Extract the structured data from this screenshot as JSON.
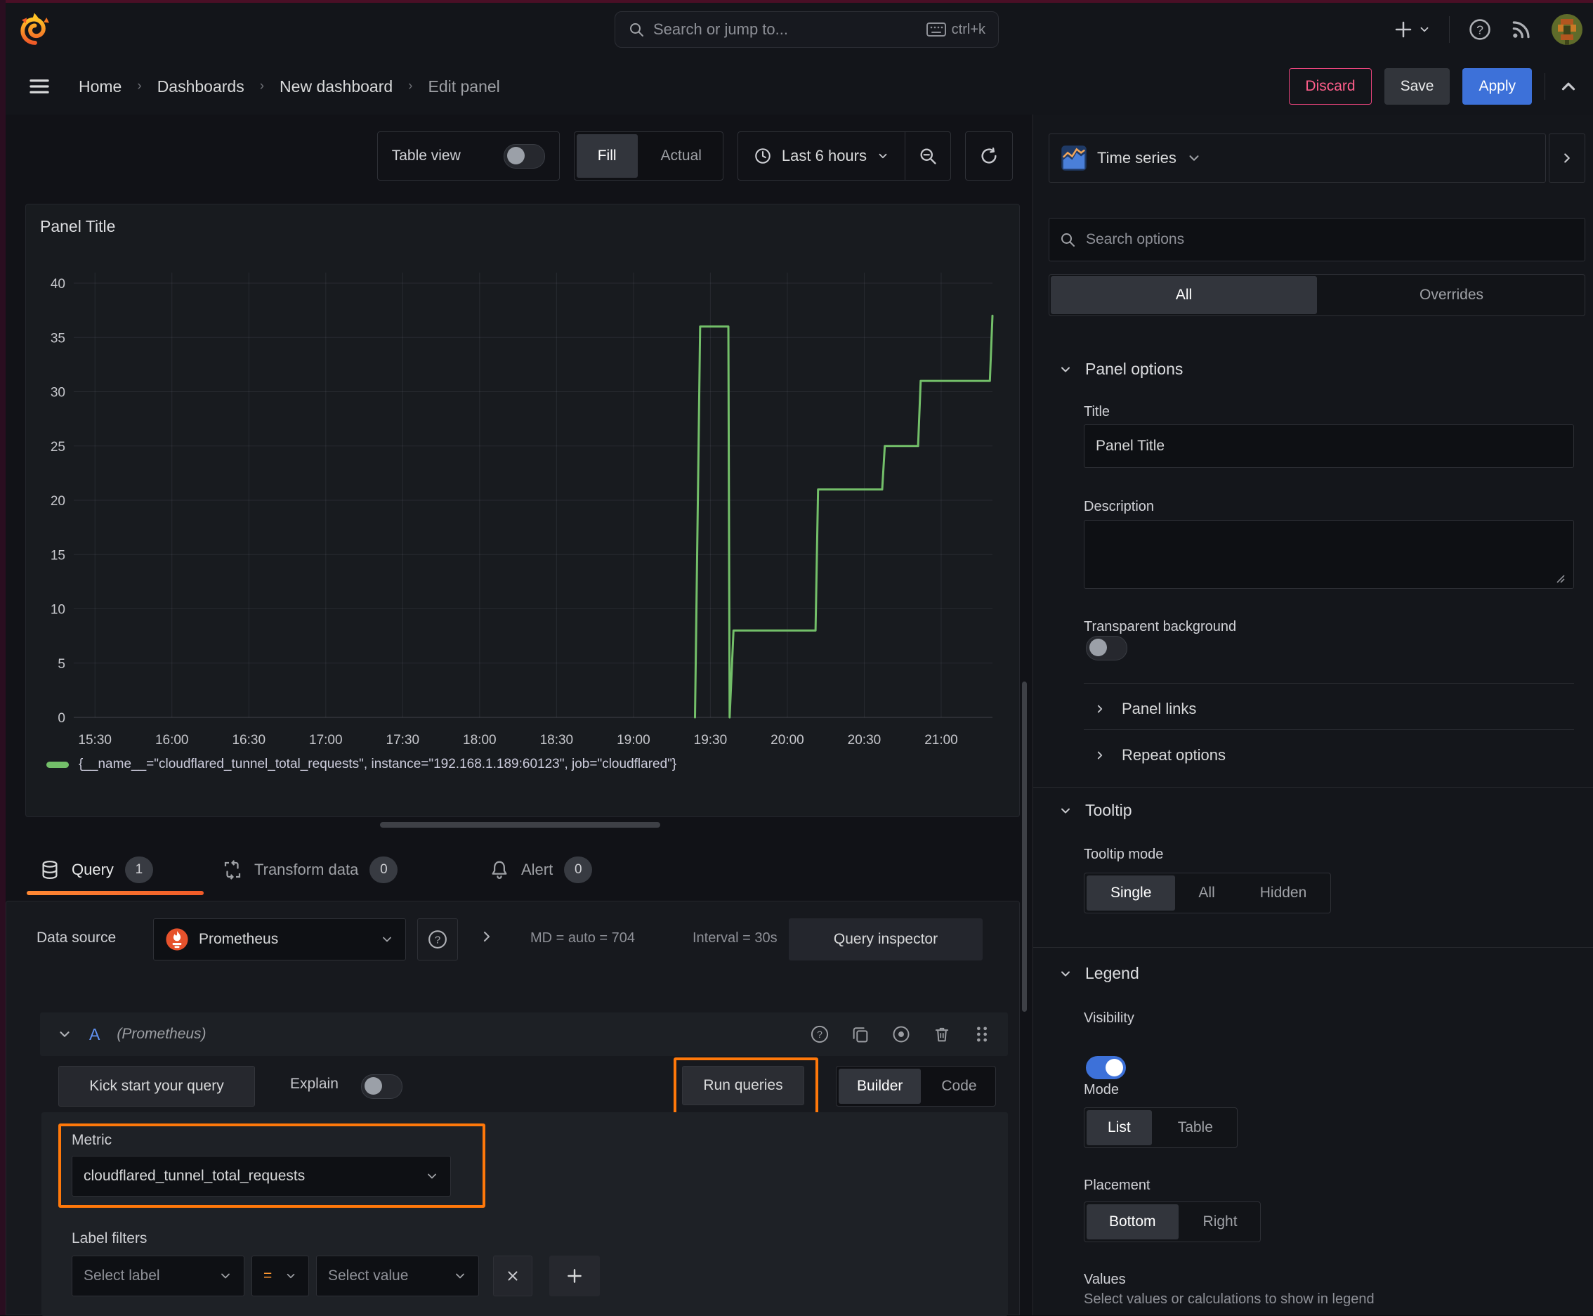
{
  "topbar": {
    "search_placeholder": "Search or jump to...",
    "shortcut": "ctrl+k"
  },
  "breadcrumb": {
    "items": [
      "Home",
      "Dashboards",
      "New dashboard",
      "Edit panel"
    ],
    "discard": "Discard",
    "save": "Save",
    "apply": "Apply"
  },
  "toolbar": {
    "table_view": "Table view",
    "fill": "Fill",
    "actual": "Actual",
    "time_range": "Last 6 hours"
  },
  "vis_picker": {
    "label": "Time series"
  },
  "panel": {
    "title": "Panel Title"
  },
  "chart_data": {
    "type": "line",
    "title": "Panel Title",
    "x_ticks": [
      "15:30",
      "16:00",
      "16:30",
      "17:00",
      "17:30",
      "18:00",
      "18:30",
      "19:00",
      "19:30",
      "20:00",
      "20:30",
      "21:00"
    ],
    "x_domain_minutes": [
      -8,
      350
    ],
    "y_ticks": [
      0,
      5,
      10,
      15,
      20,
      25,
      30,
      35,
      40
    ],
    "ylim": [
      0,
      40
    ],
    "grid": true,
    "legend_position": "bottom",
    "series": [
      {
        "name": "{__name__=\"cloudflared_tunnel_total_requests\", instance=\"192.168.1.189:60123\", job=\"cloudflared\"}",
        "color": "#73bf69",
        "points_minutes_value": [
          [
            234,
            0
          ],
          [
            236,
            36
          ],
          [
            247,
            36
          ],
          [
            247.5,
            0
          ],
          [
            249,
            8
          ],
          [
            281,
            8
          ],
          [
            282,
            21
          ],
          [
            307,
            21
          ],
          [
            308,
            25
          ],
          [
            321,
            25
          ],
          [
            322,
            31
          ],
          [
            349,
            31
          ],
          [
            350,
            37
          ]
        ]
      }
    ]
  },
  "tabs": [
    {
      "label": "Query",
      "count": "1"
    },
    {
      "label": "Transform data",
      "count": "0"
    },
    {
      "label": "Alert",
      "count": "0"
    }
  ],
  "query": {
    "data_source_label": "Data source",
    "ds_name": "Prometheus",
    "stats": "MD = auto = 704",
    "interval": "Interval = 30s",
    "inspector": "Query inspector",
    "ref": "A",
    "ref_ds": "(Prometheus)",
    "kick": "Kick start your query",
    "explain": "Explain",
    "run": "Run queries",
    "builder": "Builder",
    "code": "Code",
    "metric_label": "Metric",
    "metric": "cloudflared_tunnel_total_requests",
    "label_filters": "Label filters",
    "select_label": "Select label",
    "operator": "=",
    "select_value": "Select value"
  },
  "sidebar": {
    "search_placeholder": "Search options",
    "tab_all": "All",
    "tab_overrides": "Overrides",
    "panel_options": "Panel options",
    "title_label": "Title",
    "title_value": "Panel Title",
    "description_label": "Description",
    "transparent_label": "Transparent background",
    "panel_links": "Panel links",
    "repeat_options": "Repeat options",
    "tooltip": "Tooltip",
    "tooltip_mode": "Tooltip mode",
    "tt_single": "Single",
    "tt_all": "All",
    "tt_hidden": "Hidden",
    "legend": "Legend",
    "visibility": "Visibility",
    "mode": "Mode",
    "mode_list": "List",
    "mode_table": "Table",
    "placement": "Placement",
    "pl_bottom": "Bottom",
    "pl_right": "Right",
    "values": "Values",
    "values_help": "Select values or calculations to show in legend"
  },
  "colors": {
    "accent_orange": "#ff780a",
    "series_green": "#73bf69",
    "primary_blue": "#3d71d9",
    "discard_pink": "#e8447c"
  }
}
